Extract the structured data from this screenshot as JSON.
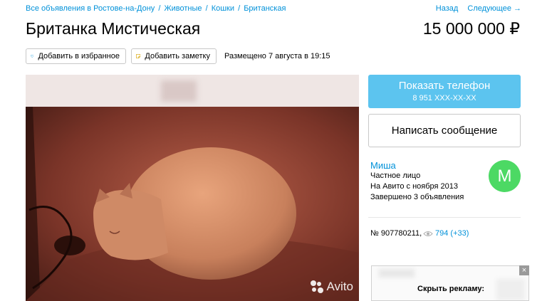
{
  "breadcrumb": {
    "items": [
      "Все объявления в Ростове-на-Дону",
      "Животные",
      "Кошки",
      "Британская"
    ],
    "separator": "/"
  },
  "nav": {
    "back": "Назад",
    "next": "Следующее →"
  },
  "listing": {
    "title": "Британка Мистическая",
    "price": "15 000 000 ₽",
    "posted": "Размещено 7 августа в 19:15",
    "item_number": "№ 907780211,",
    "views": "794 (+33)"
  },
  "actions": {
    "favorite": "Добавить в избранное",
    "note": "Добавить заметку",
    "show_phone": "Показать телефон",
    "phone_masked": "8 951 XXX-XX-XX",
    "message": "Написать сообщение"
  },
  "seller": {
    "name": "Миша",
    "type": "Частное лицо",
    "since": "На Авито с ноября 2013",
    "completed": "Завершено 3 объявления",
    "avatar_letter": "М"
  },
  "photo": {
    "watermark": "Avito"
  },
  "ad": {
    "hide_label": "Скрыть рекламу:",
    "close": "×"
  },
  "icons": [
    "heart-icon",
    "note-icon",
    "eye-icon",
    "avito-dots-icon",
    "close-icon"
  ],
  "colors": {
    "link": "#0091d9",
    "phone_button": "#5cc4ef",
    "avatar": "#4cd964"
  }
}
